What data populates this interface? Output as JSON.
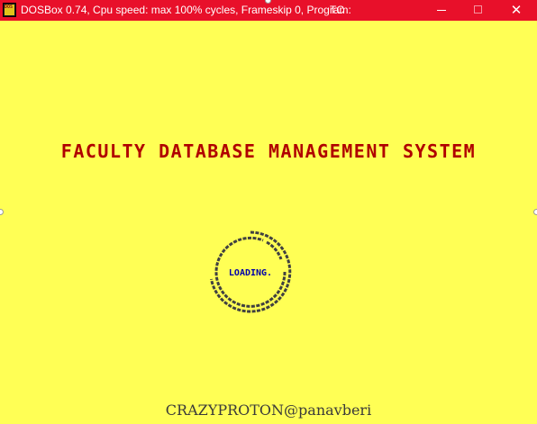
{
  "titlebar": {
    "title": "DOSBox 0.74, Cpu speed: max 100% cycles, Frameskip  0, Program:",
    "program": "TC",
    "icon_text": "DOS BOX",
    "icon": "dosbox-icon",
    "controls": {
      "minimize": "minimize-icon",
      "maximize": "maximize-icon",
      "close": "close-icon",
      "close_glyph": "✕"
    }
  },
  "screen": {
    "heading": "FACULTY DATABASE MANAGEMENT SYSTEM",
    "loading_text": "LOADING.",
    "footer": "CRAZYPROTON@panavberi"
  },
  "colors": {
    "titlebar_bg": "#e8102a",
    "screen_bg": "#ffff55",
    "heading": "#b00000",
    "loading_text": "#0000aa",
    "spinner": "#404040",
    "footer": "#3a3a3a"
  }
}
